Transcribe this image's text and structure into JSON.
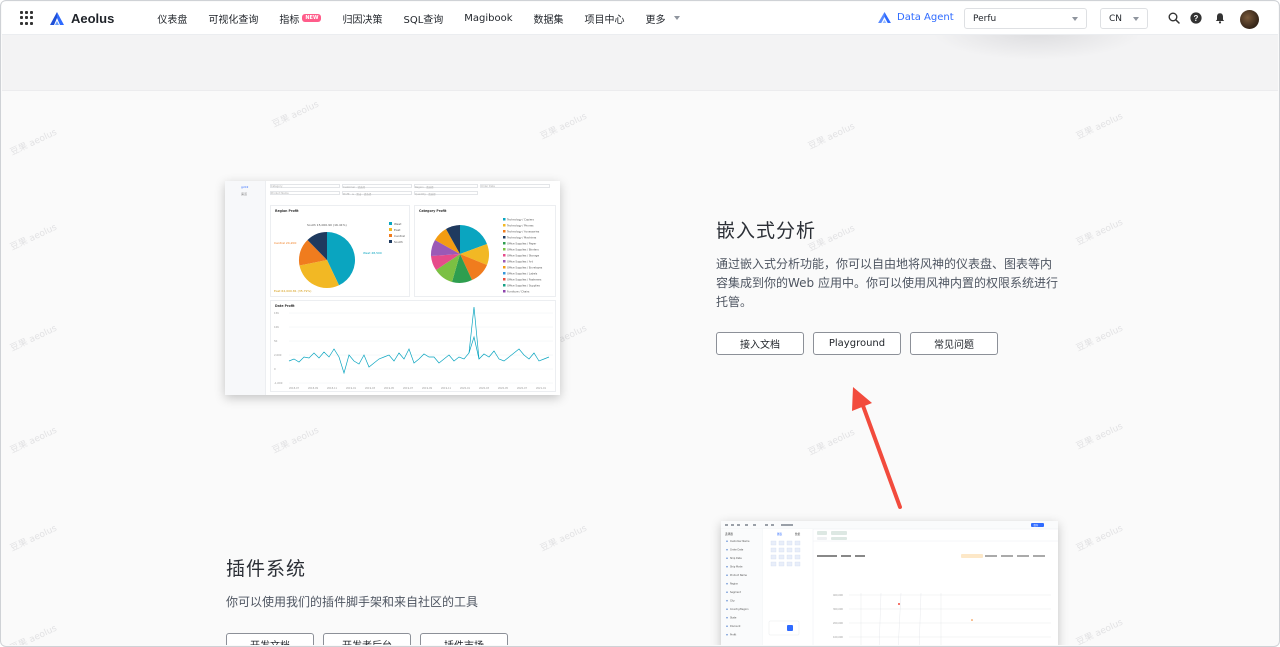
{
  "nav": {
    "app_name": "Aeolus",
    "items": [
      {
        "label": "仪表盘"
      },
      {
        "label": "可视化查询"
      },
      {
        "label": "指标",
        "badge": "NEW"
      },
      {
        "label": "归因决策"
      },
      {
        "label": "SQL查询"
      },
      {
        "label": "Magibook"
      },
      {
        "label": "数据集"
      },
      {
        "label": "项目中心"
      },
      {
        "label": "更多"
      }
    ],
    "data_agent": "Data Agent",
    "project_select": "Perfu",
    "lang_select": "CN",
    "icons": [
      "apps-grid-icon",
      "search-icon",
      "help-icon",
      "bell-icon"
    ]
  },
  "watermark": "豆果 aeolus",
  "embedded": {
    "title": "嵌入式分析",
    "desc_line1": "通过嵌入式分析功能，你可以自由地将风神的仪表盘、图表等内",
    "desc_line2": "容集成到你的Web 应用中。你可以使用风神内置的权限系统进行",
    "desc_line3": "托管。",
    "buttons": [
      "接入文档",
      "Playground",
      "常见问题"
    ]
  },
  "plugin": {
    "title": "插件系统",
    "desc": "你可以使用我们的插件脚手架和来自社区的工具",
    "buttons": [
      "开发文档",
      "开发者后台",
      "插件市场"
    ]
  },
  "preview1": {
    "sidebar": [
      "gc02",
      "渠道"
    ],
    "filters": [
      "Category",
      "Customer · 请选择",
      "Region · 请选择",
      "Order Date",
      "Product Name",
      "Profit · ≥ · 双击 · 请选择",
      "Quantity · 请选择"
    ],
    "region_chart": {
      "title": "Region Profit",
      "legend": [
        "West",
        "East",
        "Central",
        "South"
      ],
      "labels": [
        "South  15,000.90  (16.41%)",
        "Central  24,200",
        "West  48,500",
        "East  62,000.81 (35.79%)"
      ]
    },
    "category_chart": {
      "title": "Category Profit",
      "legend": [
        "Technology / Copiers",
        "Technology / Phones",
        "Technology / Accessories",
        "Technology / Machines",
        "Office Supplies / Paper",
        "Office Supplies / Binders",
        "Office Supplies / Storage",
        "Office Supplies / Art",
        "Office Supplies / Envelopes",
        "Office Supplies / Labels",
        "Office Supplies / Fasteners",
        "Office Supplies / Supplies",
        "Furniture / Chairs"
      ]
    },
    "line_chart": {
      "title": "Date Profit",
      "y_ticks": [
        "15K",
        "10K",
        "5K",
        "2,000",
        "0",
        "-1,000"
      ],
      "x_ticks": [
        "2018-07",
        "2018-09",
        "2018-11",
        "2019-01",
        "2019-03",
        "2019-05",
        "2019-07",
        "2019-09",
        "2019-11",
        "2020-01",
        "2020-03",
        "2020-05",
        "2020-07",
        "2021-01"
      ]
    }
  },
  "preview2": {
    "left_header": "选择器",
    "left_items": [
      "Customer Name",
      "Order Date",
      "Ship Date",
      "Ship Mode",
      "Product Name",
      "Region",
      "Segment",
      "City",
      "Country/Region",
      "State",
      "Discount",
      "Profit"
    ],
    "tabs": [
      "图表",
      "数据"
    ],
    "y_ticks": [
      "400,000",
      "300,000",
      "200,000",
      "100,000"
    ],
    "button": "保存"
  },
  "colors": {
    "accent": "#2f6bff",
    "arrow": "#f24b3d",
    "pie": [
      "#0aa5c0",
      "#f2b824",
      "#f07c1e",
      "#1f3a5f"
    ]
  }
}
